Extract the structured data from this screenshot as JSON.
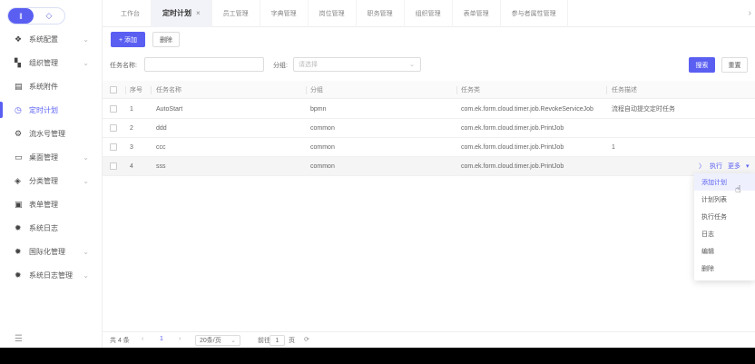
{
  "sidebar": {
    "toggle": {
      "active_icon": "‖",
      "inactive_icon": "◇"
    },
    "items": [
      {
        "icon": "layers-icon",
        "glyph": "❖",
        "label": "系统配置",
        "has_chevron": true
      },
      {
        "icon": "grid-icon",
        "glyph": "▚",
        "label": "组织管理",
        "has_chevron": true
      },
      {
        "icon": "file-icon",
        "glyph": "▤",
        "label": "系统附件",
        "has_chevron": false
      },
      {
        "icon": "clock-icon",
        "glyph": "◷",
        "label": "定时计划",
        "has_chevron": false,
        "active": true
      },
      {
        "icon": "flow-icon",
        "glyph": "⚙",
        "label": "流水号管理",
        "has_chevron": false
      },
      {
        "icon": "monitor-icon",
        "glyph": "▭",
        "label": "桌面管理",
        "has_chevron": true
      },
      {
        "icon": "tag-icon",
        "glyph": "◈",
        "label": "分类管理",
        "has_chevron": true
      },
      {
        "icon": "doc-icon",
        "glyph": "▣",
        "label": "表单管理",
        "has_chevron": false
      },
      {
        "icon": "gear-icon",
        "glyph": "✹",
        "label": "系统日志",
        "has_chevron": false
      },
      {
        "icon": "gear-icon",
        "glyph": "✹",
        "label": "国际化管理",
        "has_chevron": true
      },
      {
        "icon": "gear-icon",
        "glyph": "✹",
        "label": "系统日志管理",
        "has_chevron": true
      }
    ],
    "collapse_glyph": "☰"
  },
  "tabs": [
    {
      "label": "工作台",
      "active": false
    },
    {
      "label": "定时计划",
      "active": true,
      "close": "×"
    },
    {
      "label": "员工管理",
      "active": false
    },
    {
      "label": "字典管理",
      "active": false
    },
    {
      "label": "岗位管理",
      "active": false
    },
    {
      "label": "职务管理",
      "active": false
    },
    {
      "label": "组织管理",
      "active": false
    },
    {
      "label": "表单管理",
      "active": false
    },
    {
      "label": "参与者属性管理",
      "active": false
    }
  ],
  "tabs_more_glyph": "›",
  "toolbar": {
    "add_label": "+ 添加",
    "delete_label": "删除"
  },
  "filters": {
    "task_name_label": "任务名称:",
    "task_name_value": "",
    "group_label": "分组:",
    "group_placeholder": "请选择",
    "search_label": "搜索",
    "reset_label": "重置"
  },
  "table": {
    "headers": [
      "序号",
      "任务名称",
      "分组",
      "任务类",
      "任务描述"
    ],
    "rows": [
      {
        "no": "1",
        "name": "AutoStart",
        "group": "bpmn",
        "class": "com.ek.form.cloud.timer.job.RevokeServiceJob",
        "desc": "流程自动提交定时任务"
      },
      {
        "no": "2",
        "name": "ddd",
        "group": "common",
        "class": "com.ek.form.cloud.timer.job.PrintJob",
        "desc": ""
      },
      {
        "no": "3",
        "name": "ccc",
        "group": "common",
        "class": "com.ek.form.cloud.timer.job.PrintJob",
        "desc": "1"
      },
      {
        "no": "4",
        "name": "sss",
        "group": "common",
        "class": "com.ek.form.cloud.timer.job.PrintJob",
        "desc": ""
      }
    ],
    "row_actions": {
      "play": "〉",
      "edit": "执行",
      "more": "更多",
      "caret": "▾"
    }
  },
  "dropdown": [
    "添加计划",
    "计划列表",
    "执行任务",
    "日志",
    "编辑",
    "删除"
  ],
  "pager": {
    "total": "共 4 条",
    "prev": "‹",
    "page": "1",
    "next": "›",
    "size": "20条/页",
    "size_caret": "⌄",
    "goto": "前往",
    "goto_value": "1",
    "page_suffix": "页",
    "refresh": "⟳"
  },
  "colors": {
    "accent": "#5a5ff2"
  }
}
